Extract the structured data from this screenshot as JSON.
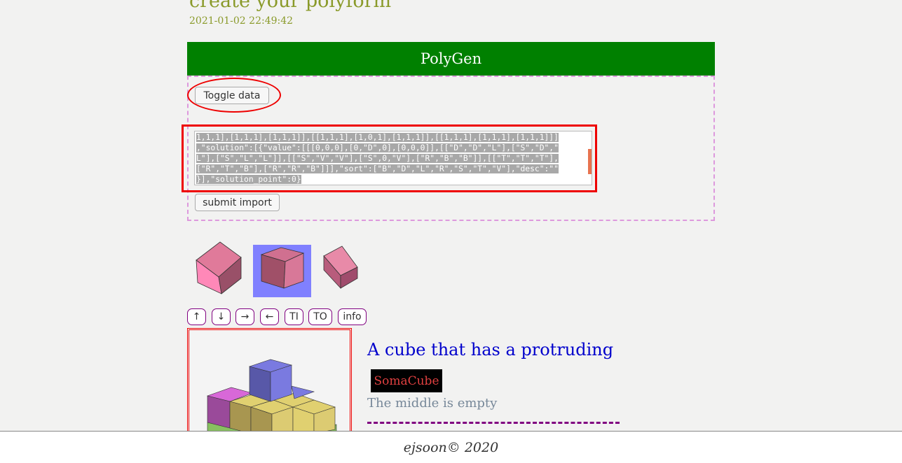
{
  "page": {
    "title": "create your polyform",
    "date": "2021-01-02 22:49:42"
  },
  "app": {
    "name": "PolyGen",
    "toggle_label": "Toggle data",
    "submit_label": "submit import",
    "data_lines": [
      "1,1,1],[1,1,1],[1,1,1]],[[1,1,1],[1,0,1],[1,1,1]],[[1,1,1],[1,1,1],[1,1,1]]]",
      ",\"solution\":[{\"value\":[[[0,0,0],[0,\"D\",0],[0,0,0]],[[\"D\",\"D\",\"L\"],[\"S\",\"D\",\"",
      "L\"],[\"S\",\"L\",\"L\"]],[[\"S\",\"V\",\"V\"],[\"S\",0,\"V\"],[\"R\",\"B\",\"B\"]],[[\"T\",\"T\",\"T\"],",
      "[\"R\",\"T\",\"B\"],[\"R\",\"R\",\"B\"]]],\"sort\":[\"B\",\"D\",\"L\",\"R\",\"S\",\"T\",\"V\"],\"desc\":\"\"",
      "}],\"solution_point\":0}"
    ],
    "nav_buttons": [
      "↑",
      "↓",
      "→",
      "←",
      "TI",
      "TO",
      "info"
    ]
  },
  "piece": {
    "title": "A cube that has a protruding",
    "tag": "SomaCube",
    "description": "The middle is empty"
  },
  "footer": {
    "text": "ejsoon© 2020"
  },
  "colors": {
    "banner": "#008000",
    "highlight": "#ff0000",
    "selected_thumb": "#8080ff",
    "cube_pink": "#e07a9a",
    "cube_purple": "#7a7ae0",
    "cube_yellow": "#e0d070",
    "cube_magenta": "#d860d8",
    "cube_green": "#80c060"
  }
}
